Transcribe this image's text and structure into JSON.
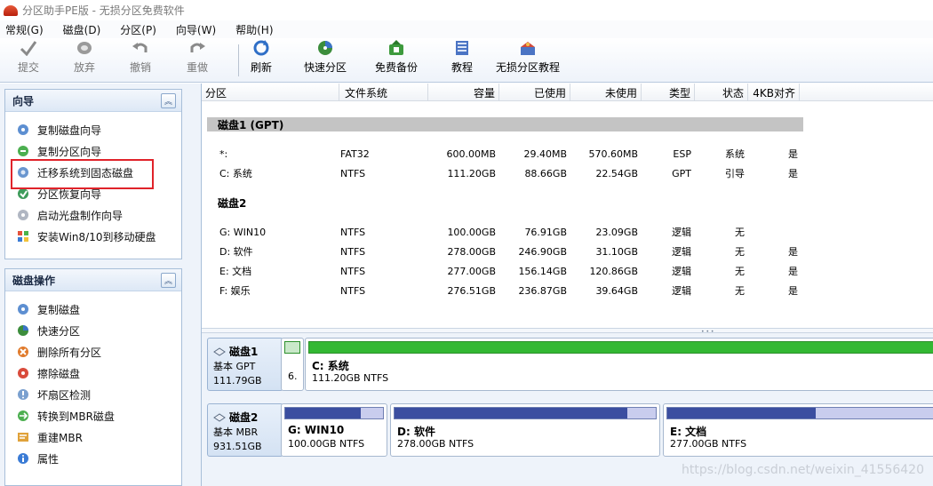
{
  "window": {
    "title": "分区助手PE版 - 无损分区免费软件"
  },
  "menu": [
    "常规(G)",
    "磁盘(D)",
    "分区(P)",
    "向导(W)",
    "帮助(H)"
  ],
  "toolbar": {
    "left": [
      {
        "label": "提交",
        "icon": "checkmark-icon"
      },
      {
        "label": "放弃",
        "icon": "discard-icon"
      },
      {
        "label": "撤销",
        "icon": "undo-icon"
      },
      {
        "label": "重做",
        "icon": "redo-icon"
      }
    ],
    "right": [
      {
        "label": "刷新",
        "icon": "refresh-icon"
      },
      {
        "label": "快速分区",
        "icon": "quick-partition-icon"
      },
      {
        "label": "免费备份",
        "icon": "backup-icon"
      },
      {
        "label": "教程",
        "icon": "tutorial-icon"
      },
      {
        "label": "无损分区教程",
        "icon": "lossless-tutorial-icon"
      }
    ]
  },
  "wizard_panel": {
    "title": "向导",
    "items": [
      "复制磁盘向导",
      "复制分区向导",
      "迁移系统到固态磁盘",
      "分区恢复向导",
      "启动光盘制作向导",
      "安装Win8/10到移动硬盘"
    ],
    "highlighted": "迁移系统到固态磁盘"
  },
  "disk_ops_panel": {
    "title": "磁盘操作",
    "items": [
      "复制磁盘",
      "快速分区",
      "删除所有分区",
      "擦除磁盘",
      "坏扇区检测",
      "转换到MBR磁盘",
      "重建MBR",
      "属性"
    ]
  },
  "table": {
    "columns": [
      "分区",
      "文件系统",
      "容量",
      "已使用",
      "未使用",
      "类型",
      "状态",
      "4KB对齐"
    ],
    "disks": [
      {
        "title": "磁盘1 (GPT)",
        "rows": [
          [
            "*:",
            "FAT32",
            "600.00MB",
            "29.40MB",
            "570.60MB",
            "ESP",
            "系统",
            "是"
          ],
          [
            "C: 系统",
            "NTFS",
            "111.20GB",
            "88.66GB",
            "22.54GB",
            "GPT",
            "引导",
            "是"
          ]
        ]
      },
      {
        "title": "磁盘2",
        "rows": [
          [
            "G: WIN10",
            "NTFS",
            "100.00GB",
            "76.91GB",
            "23.09GB",
            "逻辑",
            "无",
            ""
          ],
          [
            "D: 软件",
            "NTFS",
            "278.00GB",
            "246.90GB",
            "31.10GB",
            "逻辑",
            "无",
            "是"
          ],
          [
            "E: 文档",
            "NTFS",
            "277.00GB",
            "156.14GB",
            "120.86GB",
            "逻辑",
            "无",
            "是"
          ],
          [
            "F: 娱乐",
            "NTFS",
            "276.51GB",
            "236.87GB",
            "39.64GB",
            "逻辑",
            "无",
            "是"
          ]
        ]
      }
    ]
  },
  "disk_map": {
    "disk1": {
      "name": "磁盘1",
      "type": "基本 GPT",
      "size": "111.79GB",
      "small_part_label": "6.",
      "main_part": {
        "name": "C: 系统",
        "info": "111.20GB NTFS",
        "used_fraction": 1.0
      }
    },
    "disk2": {
      "name": "磁盘2",
      "type": "基本 MBR",
      "size": "931.51GB",
      "parts": [
        {
          "name": "G: WIN10",
          "info": "100.00GB NTFS",
          "used_fraction": 0.77
        },
        {
          "name": "D: 软件",
          "info": "278.00GB NTFS",
          "used_fraction": 0.89
        },
        {
          "name": "E: 文档",
          "info": "277.00GB NTFS",
          "used_fraction": 0.56
        }
      ]
    }
  },
  "watermark": "https://blog.csdn.net/weixin_41556420"
}
